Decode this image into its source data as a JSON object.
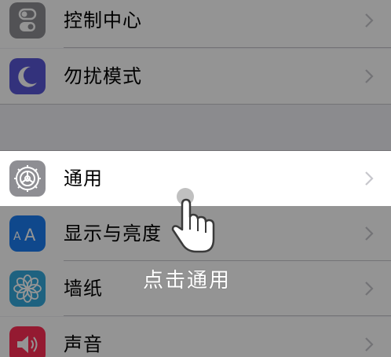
{
  "settings": {
    "items": [
      {
        "label": "控制中心",
        "icon": "control-center-icon",
        "icon_color": "#8e8e93"
      },
      {
        "label": "勿扰模式",
        "icon": "moon-icon",
        "icon_color": "#5856d6"
      },
      {
        "label": "通用",
        "icon": "gear-icon",
        "icon_color": "#8e8e93"
      },
      {
        "label": "显示与亮度",
        "icon": "text-size-icon",
        "icon_color": "#1a7df1"
      },
      {
        "label": "墙纸",
        "icon": "flower-icon",
        "icon_color": "#34aadc"
      },
      {
        "label": "声音",
        "icon": "speaker-icon",
        "icon_color": "#ff2d55"
      }
    ],
    "highlighted_item": "通用"
  },
  "tutorial": {
    "hint": "点击通用",
    "gesture_icon": "tap-hand-icon"
  },
  "colors": {
    "overlay": "#000000",
    "background": "#efeff4",
    "hint_text": "#ffffff"
  }
}
